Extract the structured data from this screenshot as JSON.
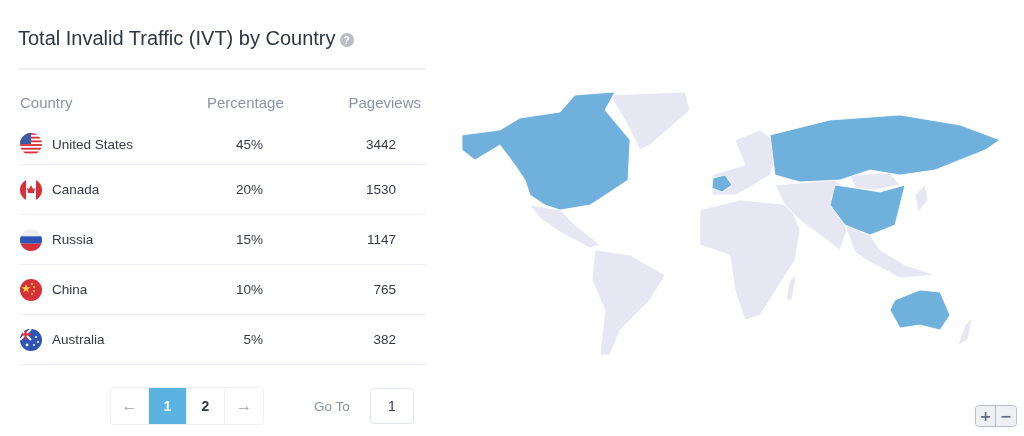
{
  "title": "Total Invalid Traffic (IVT) by Country",
  "help_icon": "?",
  "table": {
    "columns": [
      "Country",
      "Percentage",
      "Pageviews"
    ],
    "rows": [
      {
        "country": "United States",
        "percentage": "45%",
        "pageviews": "3442"
      },
      {
        "country": "Canada",
        "percentage": "20%",
        "pageviews": "1530"
      },
      {
        "country": "Russia",
        "percentage": "15%",
        "pageviews": "1147"
      },
      {
        "country": "China",
        "percentage": "10%",
        "pageviews": "765"
      },
      {
        "country": "Australia",
        "percentage": "5%",
        "pageviews": "382"
      }
    ]
  },
  "pagination": {
    "prev": "←",
    "next": "→",
    "pages": [
      {
        "label": "1",
        "selected": true
      },
      {
        "label": "2",
        "selected": false
      }
    ],
    "goto_label": "Go To",
    "goto_value": "1"
  },
  "map": {
    "kind": "picture",
    "zoom_in": "+",
    "zoom_out": "−"
  }
}
